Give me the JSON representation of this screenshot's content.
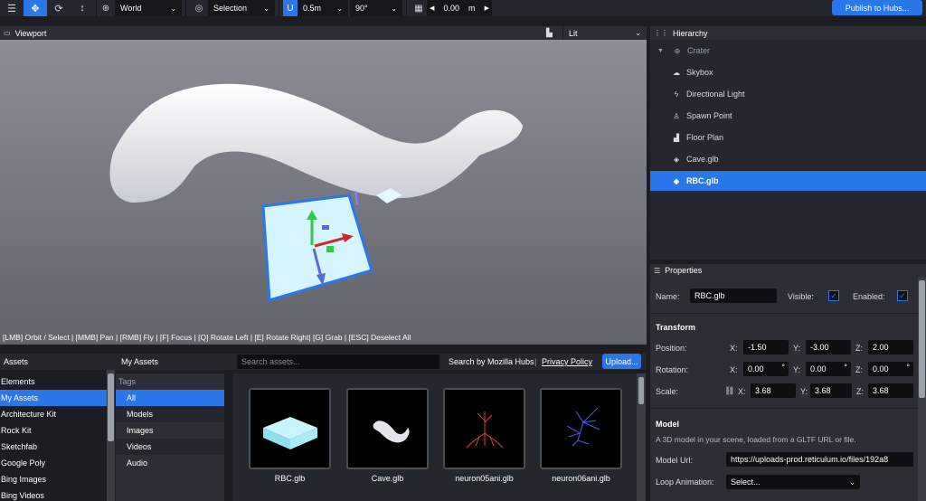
{
  "toolbar": {
    "coordinate_space": "World",
    "transform_pivot": "Selection",
    "translation_snap": "0.5m",
    "rotation_snap": "90°",
    "grid_height": "0.00",
    "grid_unit": "m",
    "publish_label": "Publish to Hubs..."
  },
  "viewport": {
    "title": "Viewport",
    "render_mode": "Lit",
    "controls_hint": "[LMB] Orbit / Select | [MMB] Pan | [RMB] Fly | [F] Focus | [Q] Rotate Left | [E] Rotate Right| [G] Grab | [ESC] Deselect All"
  },
  "hierarchy": {
    "title": "Hierarchy",
    "items": [
      {
        "label": "Crater",
        "icon": "globe-icon"
      },
      {
        "label": "Skybox",
        "icon": "cloud-icon"
      },
      {
        "label": "Directional Light",
        "icon": "bolt-icon"
      },
      {
        "label": "Spawn Point",
        "icon": "person-icon"
      },
      {
        "label": "Floor Plan",
        "icon": "shoe-icon"
      },
      {
        "label": "Cave.glb",
        "icon": "cube-icon"
      },
      {
        "label": "RBC.glb",
        "icon": "cube-icon"
      }
    ]
  },
  "properties": {
    "title": "Properties",
    "name_label": "Name:",
    "name_value": "RBC.glb",
    "visible_label": "Visible:",
    "enabled_label": "Enabled:",
    "transform_label": "Transform",
    "position_label": "Position:",
    "rotation_label": "Rotation:",
    "scale_label": "Scale:",
    "axis_x": "X:",
    "axis_y": "Y:",
    "axis_z": "Z:",
    "degree_unit": "°",
    "position": [
      "-1.50",
      "-3.00",
      "2.00"
    ],
    "rotation": [
      "0.00",
      "0.00",
      "0.00"
    ],
    "scale": [
      "3.68",
      "3.68",
      "3.68"
    ],
    "model_label": "Model",
    "model_desc": "A 3D model in your scene, loaded from a GLTF URL or file.",
    "model_url_label": "Model Url:",
    "model_url_value": "https://uploads-prod.reticulum.io/files/192a8",
    "loop_animation_label": "Loop Animation:",
    "loop_animation_value": "Select..."
  },
  "assets": {
    "title": "Assets",
    "sources": [
      "Elements",
      "My Assets",
      "Architecture Kit",
      "Rock Kit",
      "Sketchfab",
      "Google Poly",
      "Bing Images",
      "Bing Videos"
    ],
    "section_title": "My Assets",
    "search_placeholder": "Search assets...",
    "search_by": "Search by Mozilla Hubs",
    "privacy": "Privacy Policy",
    "upload": "Upload...",
    "tags_label": "Tags",
    "tags": [
      "All",
      "Models",
      "Images",
      "Videos",
      "Audio"
    ],
    "items": [
      {
        "label": "RBC.glb"
      },
      {
        "label": "Cave.glb"
      },
      {
        "label": "neuron05ani.glb"
      },
      {
        "label": "neuron06ani.glb"
      }
    ]
  }
}
